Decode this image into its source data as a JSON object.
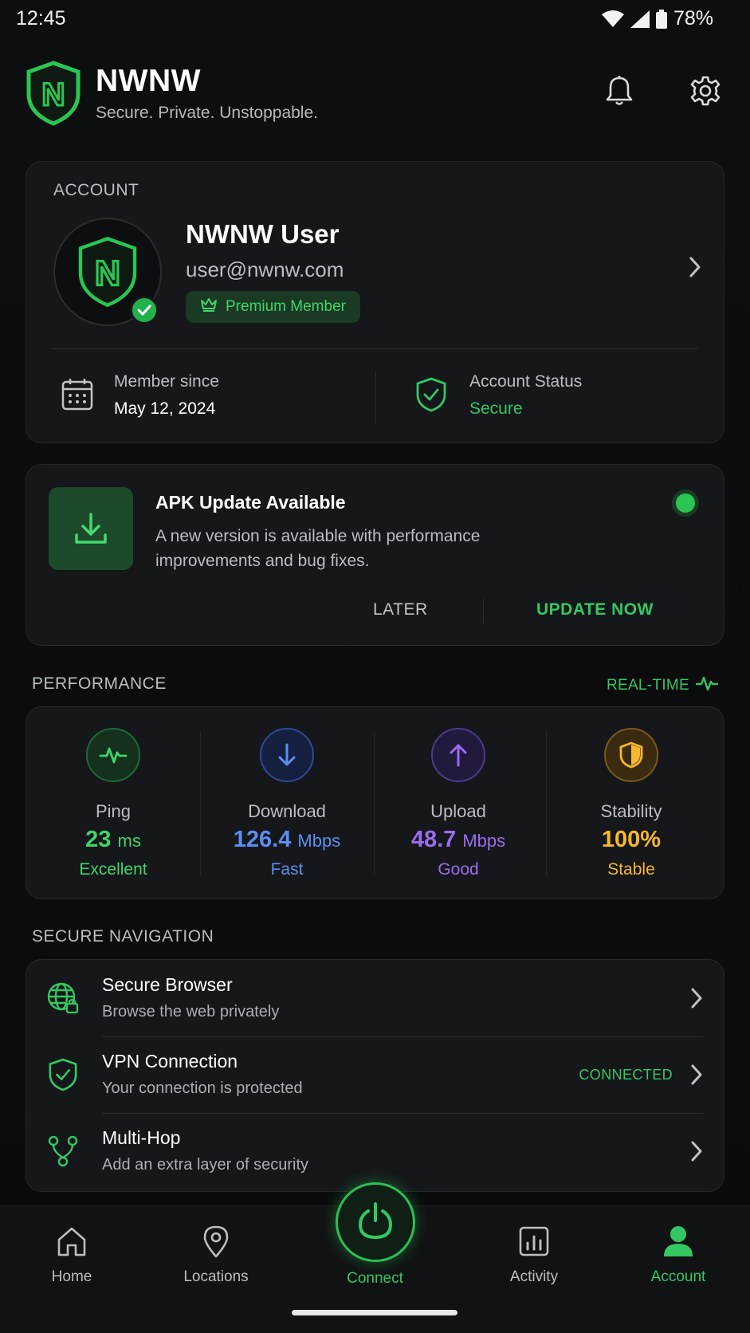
{
  "status_bar": {
    "time": "12:45",
    "battery": "78%"
  },
  "header": {
    "title": "NWNW",
    "tagline": "Secure. Private. Unstoppable.",
    "logo_letter": "N"
  },
  "account": {
    "section_label": "ACCOUNT",
    "name": "NWNW User",
    "email": "user@nwnw.com",
    "badge": "Premium Member",
    "member_since_label": "Member since",
    "member_since_value": "May 12, 2024",
    "status_label": "Account Status",
    "status_value": "Secure"
  },
  "update": {
    "title": "APK Update Available",
    "description": "A new version is available with performance improvements and bug fixes.",
    "later_label": "LATER",
    "update_label": "UPDATE NOW"
  },
  "performance": {
    "section_label": "PERFORMANCE",
    "realtime_label": "REAL-TIME",
    "metrics": [
      {
        "name": "Ping",
        "value": "23",
        "unit": "ms",
        "quality": "Excellent",
        "color": "#3fd56a",
        "icon": "pulse-icon"
      },
      {
        "name": "Download",
        "value": "126.4",
        "unit": "Mbps",
        "quality": "Fast",
        "color": "#5b8ff0",
        "icon": "arrow-down-icon"
      },
      {
        "name": "Upload",
        "value": "48.7",
        "unit": "Mbps",
        "quality": "Good",
        "color": "#9a6cf0",
        "icon": "arrow-up-icon"
      },
      {
        "name": "Stability",
        "value": "100%",
        "unit": "",
        "quality": "Stable",
        "color": "#f5b82e",
        "icon": "shield-half-icon"
      }
    ]
  },
  "secure_navigation": {
    "section_label": "SECURE NAVIGATION",
    "items": [
      {
        "title": "Secure Browser",
        "subtitle": "Browse the web privately",
        "icon": "globe-lock-icon",
        "status": ""
      },
      {
        "title": "VPN Connection",
        "subtitle": "Your connection is protected",
        "icon": "shield-check-icon",
        "status": "CONNECTED"
      },
      {
        "title": "Multi-Hop",
        "subtitle": "Add an extra layer of security",
        "icon": "multi-hop-icon",
        "status": ""
      }
    ]
  },
  "bottom_nav": {
    "tabs": [
      {
        "label": "Home",
        "icon": "home-icon"
      },
      {
        "label": "Locations",
        "icon": "location-pin-icon"
      },
      {
        "label": "Connect",
        "icon": "power-icon"
      },
      {
        "label": "Activity",
        "icon": "bar-chart-icon"
      },
      {
        "label": "Account",
        "icon": "user-icon"
      }
    ],
    "active": "Account"
  },
  "colors": {
    "accent": "#35c763",
    "background": "#0b0c0e",
    "card": "#15171a"
  }
}
